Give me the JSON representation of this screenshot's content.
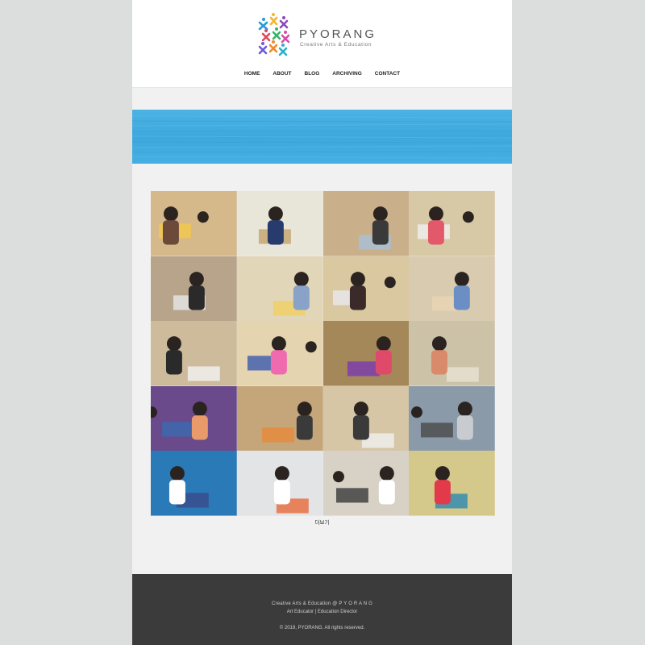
{
  "brand": {
    "name": "PYORANG",
    "tagline": "Creative Arts & Education"
  },
  "nav": {
    "items": [
      "HOME",
      "ABOUT",
      "BLOG",
      "ARCHIVING",
      "CONTACT"
    ]
  },
  "gallery": {
    "more_label": "더보기",
    "tiles": [
      {
        "bg": "#d6b98a",
        "accent": "#6b4a3a",
        "detail": "#f4c84a"
      },
      {
        "bg": "#e8e6d8",
        "accent": "#273c6d",
        "detail": "#c3a36b"
      },
      {
        "bg": "#c9b08a",
        "accent": "#3a3a3a",
        "detail": "#a8c1d6"
      },
      {
        "bg": "#d8c9a6",
        "accent": "#e25a6a",
        "detail": "#f0f0f0"
      },
      {
        "bg": "#b8a48a",
        "accent": "#2a2a2a",
        "detail": "#e6e6e6"
      },
      {
        "bg": "#e2d6b8",
        "accent": "#88a2c8",
        "detail": "#f0d060"
      },
      {
        "bg": "#d9c8a0",
        "accent": "#3a2a2a",
        "detail": "#e8e8f0"
      },
      {
        "bg": "#d8cbb0",
        "accent": "#6b8fc4",
        "detail": "#e8d4b4"
      },
      {
        "bg": "#cdbb9c",
        "accent": "#2a2a2a",
        "detail": "#f2f2f2"
      },
      {
        "bg": "#e4d4b0",
        "accent": "#f06ab0",
        "detail": "#3a5ab0"
      },
      {
        "bg": "#a4885a",
        "accent": "#e04a6a",
        "detail": "#7a3ab0"
      },
      {
        "bg": "#ccc2a8",
        "accent": "#d88a6a",
        "detail": "#e8e2d2"
      },
      {
        "bg": "#6a4a8a",
        "accent": "#e89a6a",
        "detail": "#3a6ab0"
      },
      {
        "bg": "#c4a67a",
        "accent": "#3a3a3a",
        "detail": "#e88a3a"
      },
      {
        "bg": "#d6c6a6",
        "accent": "#3a3a3a",
        "detail": "#f0f0f0"
      },
      {
        "bg": "#8a9aa8",
        "accent": "#c8ccd0",
        "detail": "#4a4a4a"
      },
      {
        "bg": "#2a7ab8",
        "accent": "#ffffff",
        "detail": "#3a4a8a"
      },
      {
        "bg": "#e2e4e6",
        "accent": "#ffffff",
        "detail": "#e86a3a"
      },
      {
        "bg": "#d8d2c6",
        "accent": "#ffffff",
        "detail": "#3a3a3a"
      },
      {
        "bg": "#d4c88a",
        "accent": "#e23a4a",
        "detail": "#2a8ab0"
      }
    ]
  },
  "footer": {
    "line1": "Creative Arts & Education @ P Y O R A N G",
    "line2": "Art Educator  |  Education Director",
    "copyright": "© 2019, PYORANG. All rights reserved."
  },
  "colors": {
    "banner": "#45aee2",
    "footer_bg": "#3b3b3b",
    "page_bg": "#f1f1f1"
  }
}
